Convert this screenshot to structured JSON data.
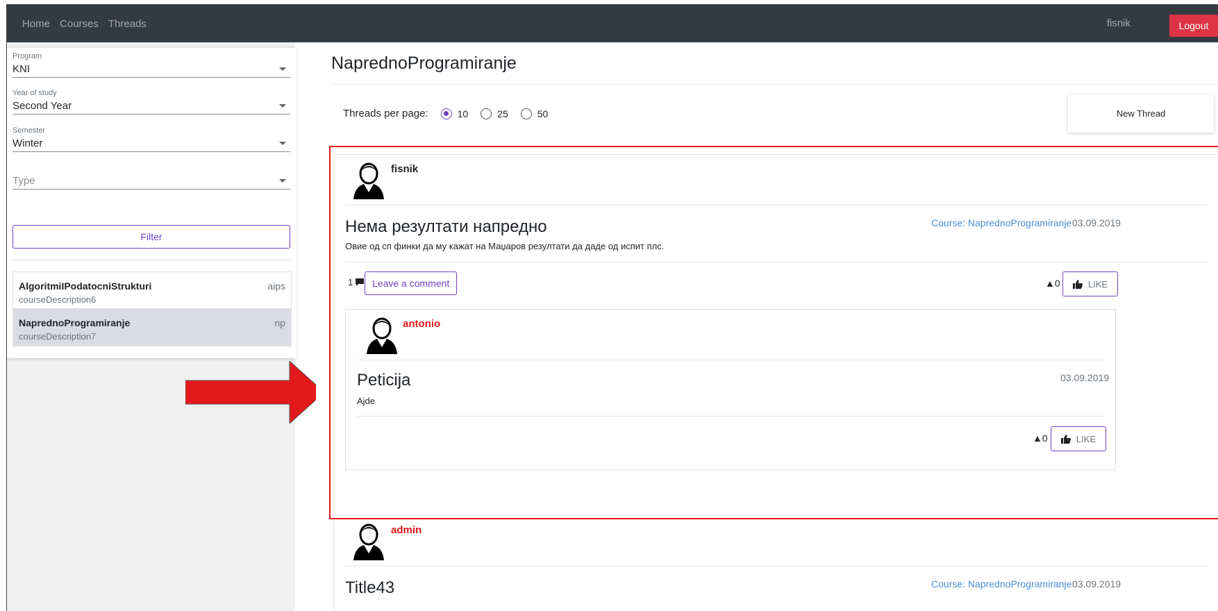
{
  "nav": {
    "links": [
      "Home",
      "Courses",
      "Threads"
    ],
    "user": "fisnik",
    "logout_label": "Logout"
  },
  "filters": {
    "program": {
      "label": "Program",
      "value": "KNI"
    },
    "year": {
      "label": "Year of study",
      "value": "Second Year"
    },
    "semester": {
      "label": "Semester",
      "value": "Winter"
    },
    "type": {
      "placeholder": "Type"
    },
    "filter_label": "Filter"
  },
  "courses": [
    {
      "name": "AlgoritmiIPodatocniStrukturi",
      "code": "aips",
      "description": "courseDescription6",
      "active": false
    },
    {
      "name": "NaprednoProgramiranje",
      "code": "np",
      "description": "courseDescription7",
      "active": true
    }
  ],
  "main": {
    "title": "NaprednoProgramiranje",
    "threads_per_page_label": "Threads per page:",
    "page_size_options": [
      "10",
      "25",
      "50"
    ],
    "page_size_selected": "10",
    "new_thread_label": "New Thread"
  },
  "threads": [
    {
      "author": "fisnik",
      "author_color": "#000000",
      "title": "Нема резултати напредно",
      "course": "Course: NaprednoProgramiranje",
      "date": "03.09.2019",
      "body": "Овие од сп финки да му кажат на Маџаров резултати да даде од испит плс.",
      "comment_count": "1",
      "comment_button": "Leave a comment",
      "votes": "▲0",
      "like_label": "LIKE",
      "reply": {
        "author": "antonio",
        "author_color": "#e3191b",
        "title": "Peticija",
        "date": "03.09.2019",
        "body": "Ajde",
        "votes": "▲0",
        "like_label": "LIKE"
      }
    },
    {
      "author": "admin",
      "author_color": "#e3191b",
      "title": "Title43",
      "course": "Course: NaprednoProgramiranje",
      "date": "03.09.2019"
    }
  ],
  "colors": {
    "navbar": "#343a40",
    "logout": "#dc3545",
    "accent": "#6f42c1",
    "link": "#4a8fd3",
    "highlight": "#e3191b"
  }
}
